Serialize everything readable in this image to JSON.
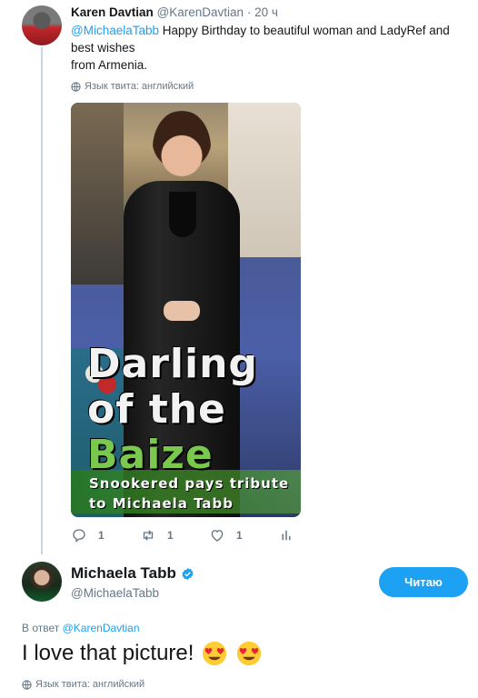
{
  "tweet1": {
    "name": "Karen Davtian",
    "handle": "@KarenDavtian",
    "dot": "·",
    "time": "20 ч",
    "mention": "@MichaelaTabb",
    "text": "Happy Birthday to beautiful woman and LadyRef and best wishes",
    "text_cont": "from Armenia.",
    "language": "Язык твита: английский",
    "image": {
      "line1": "Darling",
      "line2": "of the",
      "line3": "Baize",
      "line4": "Snookered pays tribute",
      "line5": "to Michaela Tabb"
    },
    "actions": {
      "reply_count": "1",
      "retweet_count": "1",
      "like_count": "1"
    }
  },
  "tweet2": {
    "name": "Michaela Tabb",
    "handle": "@MichaelaTabb",
    "follow_label": "Читаю",
    "reply_prefix": "В ответ",
    "reply_to": "@KarenDavtian",
    "text": "I love that picture!",
    "emoji": [
      "smiling-face-heart-eyes",
      "smiling-face-heart-eyes"
    ],
    "language": "Язык твита: английский"
  },
  "colors": {
    "accent": "#1da1f2",
    "secondary_text": "#657786",
    "primary_text": "#14171a"
  }
}
